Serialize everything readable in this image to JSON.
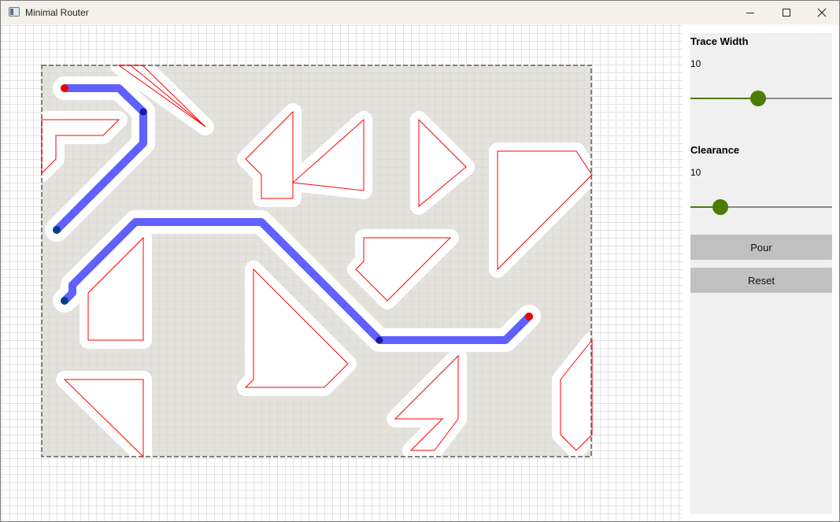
{
  "window": {
    "title": "Minimal Router"
  },
  "panel": {
    "trace_width": {
      "label": "Trace Width",
      "value": "10",
      "slider_fraction": 0.48
    },
    "clearance": {
      "label": "Clearance",
      "value": "10",
      "slider_fraction": 0.21
    },
    "pour_label": "Pour",
    "reset_label": "Reset"
  },
  "colors": {
    "accent": "#4a7d00",
    "trace": "#4444ff",
    "obstacle_outline": "#ff0000",
    "pad_start": "#ee0000",
    "pad_end": "#003f8f",
    "board_fill": "#e3e2dc"
  },
  "icons": {
    "app": "app-window-icon",
    "minimize": "minimize-icon",
    "maximize": "maximize-icon",
    "close": "close-icon"
  }
}
